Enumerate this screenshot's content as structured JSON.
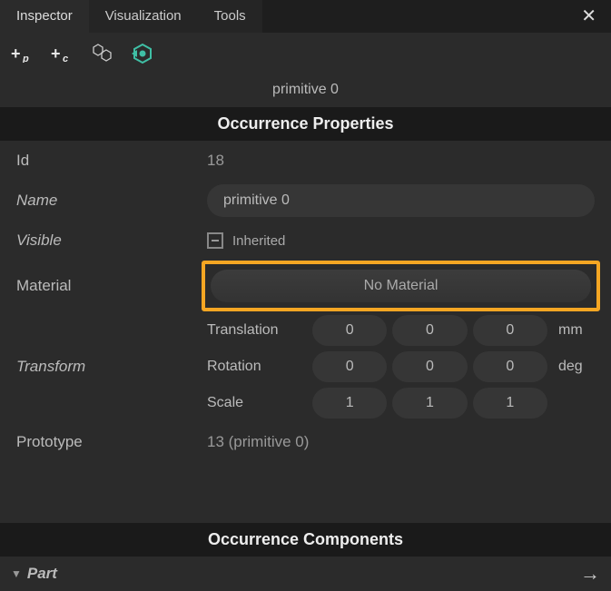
{
  "tabs": {
    "inspector": "Inspector",
    "visualization": "Visualization",
    "tools": "Tools"
  },
  "objectName": "primitive 0",
  "sections": {
    "occurrenceProperties": "Occurrence Properties",
    "occurrenceComponents": "Occurrence Components"
  },
  "props": {
    "idLabel": "Id",
    "idValue": "18",
    "nameLabel": "Name",
    "nameValue": "primitive 0",
    "visibleLabel": "Visible",
    "visibleValue": "Inherited",
    "materialLabel": "Material",
    "materialValue": "No Material",
    "transformLabel": "Transform",
    "prototypeLabel": "Prototype",
    "prototypeValue": "13 (primitive 0)"
  },
  "transform": {
    "translation": {
      "label": "Translation",
      "x": "0",
      "y": "0",
      "z": "0",
      "unit": "mm"
    },
    "rotation": {
      "label": "Rotation",
      "x": "0",
      "y": "0",
      "z": "0",
      "unit": "deg"
    },
    "scale": {
      "label": "Scale",
      "x": "1",
      "y": "1",
      "z": "1",
      "unit": ""
    }
  },
  "part": {
    "label": "Part"
  }
}
